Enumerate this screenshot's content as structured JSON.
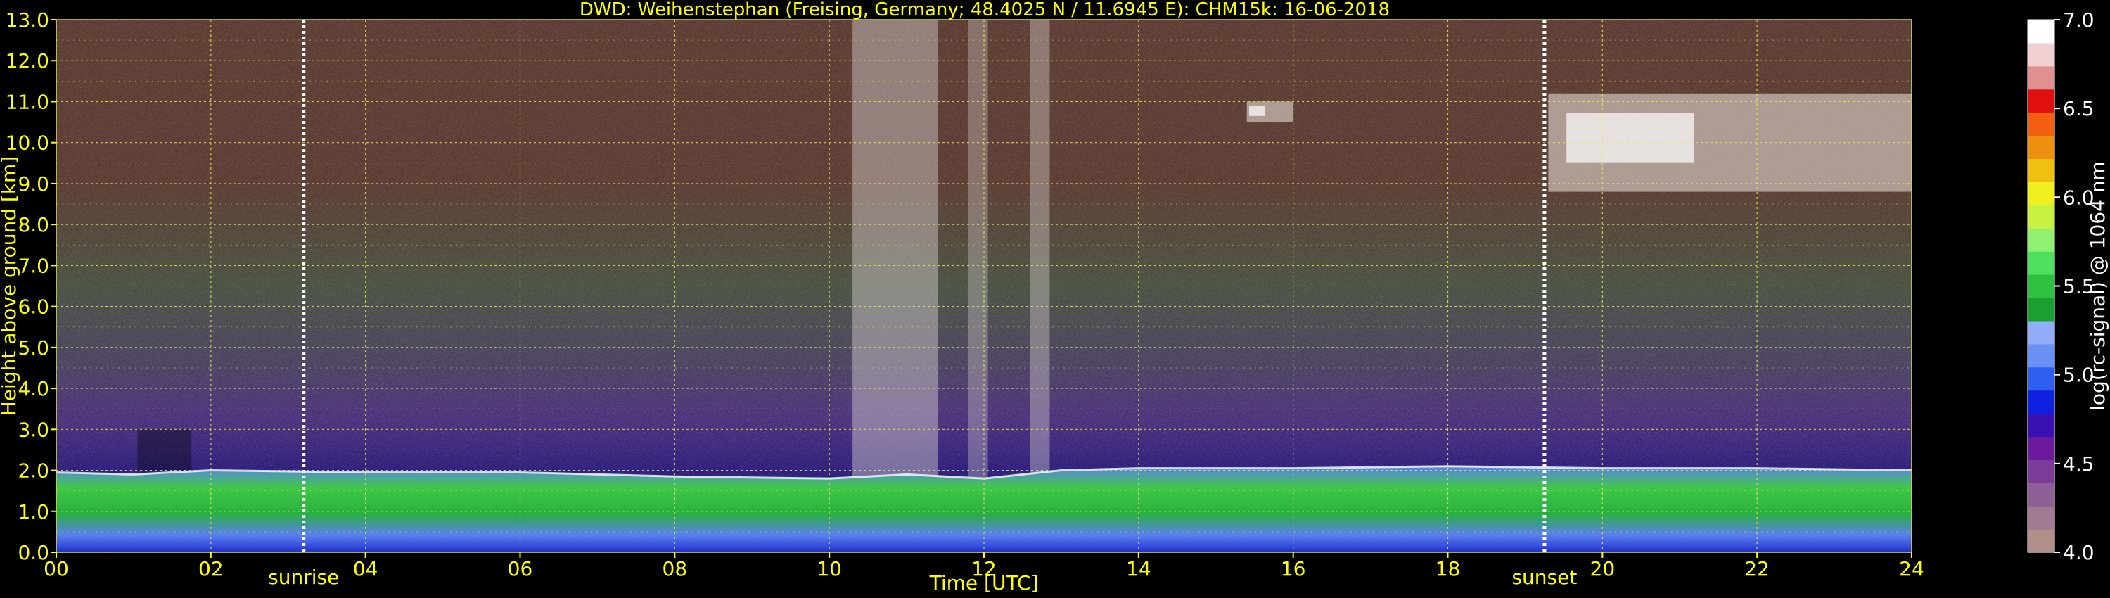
{
  "chart_data": {
    "type": "heatmap",
    "title": "DWD: Weihenstephan (Freising, Germany; 48.4025 N / 11.6945 E):    CHM15k: 16-06-2018",
    "xlabel": "Time [UTC]",
    "ylabel": "Height above ground [km]",
    "xlim": [
      0,
      24
    ],
    "ylim": [
      0,
      13
    ],
    "x_ticks": [
      "00",
      "02",
      "04",
      "06",
      "08",
      "10",
      "12",
      "14",
      "16",
      "18",
      "20",
      "22",
      "24"
    ],
    "y_ticks": [
      "0.0",
      "1.0",
      "2.0",
      "3.0",
      "4.0",
      "5.0",
      "6.0",
      "7.0",
      "8.0",
      "9.0",
      "10.0",
      "11.0",
      "12.0",
      "13.0"
    ],
    "y_minor_ticks": [
      "0.5",
      "1.5",
      "2.5",
      "3.5",
      "4.5",
      "5.5",
      "6.5",
      "7.5",
      "8.5",
      "9.5",
      "10.5",
      "11.5",
      "12.5"
    ],
    "grid": true,
    "colorbar": {
      "label": "log(rc-signal) @ 1064 nm",
      "range": [
        4.0,
        7.0
      ],
      "ticks": [
        "4.0",
        "4.5",
        "5.0",
        "5.5",
        "6.0",
        "6.5",
        "7.0"
      ],
      "colors": [
        "#b09088",
        "#a07a90",
        "#8c5f96",
        "#7a3c98",
        "#6a1a9a",
        "#3a10b0",
        "#1020e0",
        "#2e5ff0",
        "#6a90f4",
        "#92aef8",
        "#1aa030",
        "#30c040",
        "#50e060",
        "#90f070",
        "#c8f040",
        "#f0f020",
        "#f0c010",
        "#f09010",
        "#f06010",
        "#e01010",
        "#e09090",
        "#f0d0d0",
        "#ffffff"
      ]
    },
    "annotations": [
      {
        "text": "sunrise",
        "x": 3.2
      },
      {
        "text": "sunset",
        "x": 19.25
      }
    ],
    "boundary_layer_top_km": [
      [
        0.0,
        1.95
      ],
      [
        1.0,
        1.9
      ],
      [
        2.0,
        2.0
      ],
      [
        4.0,
        1.95
      ],
      [
        6.0,
        1.95
      ],
      [
        8.0,
        1.85
      ],
      [
        10.0,
        1.8
      ],
      [
        11.0,
        1.9
      ],
      [
        12.0,
        1.8
      ],
      [
        13.0,
        2.0
      ],
      [
        14.0,
        2.05
      ],
      [
        16.0,
        2.05
      ],
      [
        18.0,
        2.1
      ],
      [
        20.0,
        2.05
      ],
      [
        22.0,
        2.05
      ],
      [
        24.0,
        2.0
      ]
    ],
    "cloud_layers": [
      {
        "x_start": 19.3,
        "x_end": 24.0,
        "base_km": 8.8,
        "top_km": 11.2
      },
      {
        "x_start": 15.4,
        "x_end": 16.0,
        "base_km": 10.5,
        "top_km": 11.0
      }
    ],
    "colors": {
      "background": "#000000",
      "text": "#ffff00",
      "grid": "#e8e85a",
      "sun_lines": "#ffffff"
    }
  }
}
